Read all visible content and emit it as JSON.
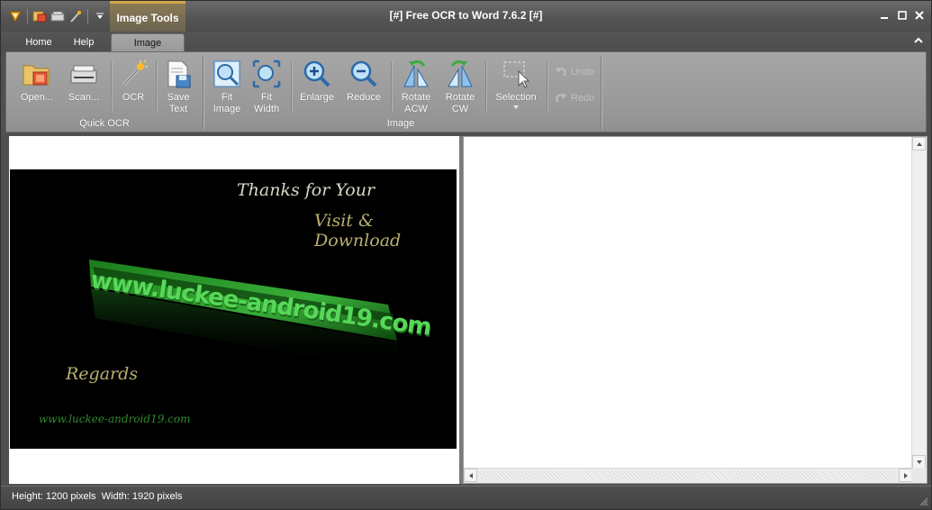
{
  "window": {
    "title": "[#] Free OCR to Word 7.6.2 [#]",
    "context_tab": "Image Tools"
  },
  "tabs": [
    {
      "label": "Home",
      "active": false
    },
    {
      "label": "Help",
      "active": false
    },
    {
      "label": "Image",
      "active": true
    }
  ],
  "ribbon": {
    "groups": {
      "quick_ocr": "Quick OCR",
      "image": "Image"
    },
    "buttons": {
      "open": "Open...",
      "scan": "Scan...",
      "ocr": "OCR",
      "save_text": "Save\nText",
      "fit_image": "Fit\nImage",
      "fit_width": "Fit\nWidth",
      "enlarge": "Enlarge",
      "reduce": "Reduce",
      "rotate_acw": "Rotate\nACW",
      "rotate_cw": "Rotate\nCW",
      "selection": "Selection"
    },
    "undo": "Undo",
    "redo": "Redo"
  },
  "preview": {
    "line1": "Thanks for Your",
    "line2": "Visit & Download",
    "brand": "www.luckee-android19.com",
    "regards": "Regards"
  },
  "status": {
    "text": "Height: 1200 pixels  Width: 1920 pixels"
  },
  "colors": {
    "accent": "#d2a64a",
    "ribbon": "#9c9c9c",
    "chrome": "#505050"
  }
}
